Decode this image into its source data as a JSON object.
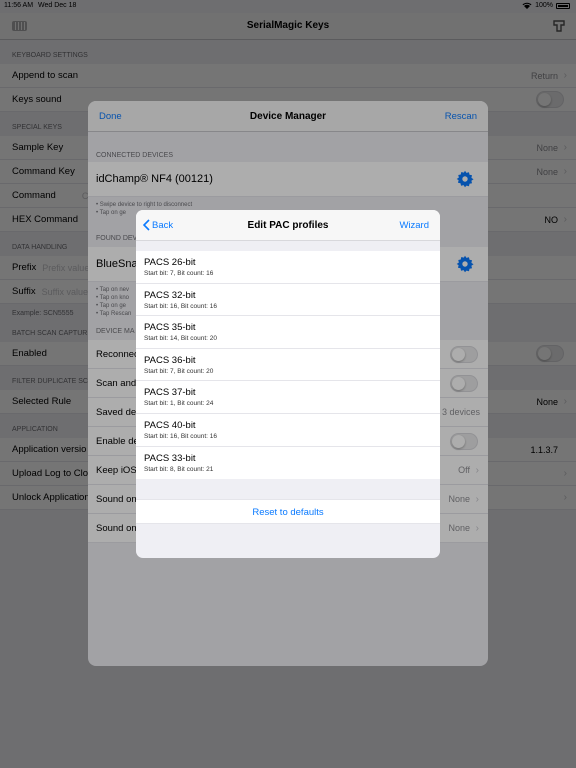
{
  "status_bar": {
    "time": "11:56 AM",
    "date": "Wed Dec 18",
    "battery": "100%"
  },
  "app": {
    "title": "SerialMagic Keys"
  },
  "settings": {
    "keyboard_header": "KEYBOARD SETTINGS",
    "append_label": "Append to scan",
    "append_value": "Return",
    "keys_sound_label": "Keys sound",
    "special_header": "SPECIAL KEYS",
    "sample_key_label": "Sample Key",
    "sample_key_value": "None",
    "command_key_label": "Command Key",
    "command_key_value": "None",
    "command_label": "Command",
    "command_placeholder": "C",
    "hex_label": "HEX Command",
    "hex_value": "NO",
    "data_header": "DATA HANDLING",
    "prefix_label": "Prefix",
    "prefix_placeholder": "Prefix value",
    "suffix_label": "Suffix",
    "suffix_placeholder": "Suffix value",
    "example_text": "Example: SCN5555",
    "batch_header": "BATCH SCAN CAPTUR",
    "enabled_label": "Enabled",
    "filter_header": "FILTER DUPLICATE SC",
    "selected_rule_label": "Selected Rule",
    "selected_rule_value": "None",
    "application_header": "APPLICATION",
    "app_version_label": "Application versio",
    "app_version_value": "1.1.3.7",
    "upload_log_label": "Upload Log to Clo",
    "unlock_label": "Unlock Application"
  },
  "device_manager": {
    "done": "Done",
    "title": "Device Manager",
    "rescan": "Rescan",
    "connected_header": "CONNECTED DEVICES",
    "connected_device": "idChamp® NF4 (00121)",
    "connected_note_1": "• Swipe device to right to disconnect",
    "connected_note_2": "• Tap on ge",
    "found_header": "FOUND DEV",
    "found_device": "BlueSna",
    "found_note_1": "• Tap on nev",
    "found_note_2": "• Tap on kno",
    "found_note_3": "• Tap on ge",
    "found_note_4": "• Tap Rescan",
    "device_mgmt_header": "DEVICE MA",
    "reconnect_label": "Reconnec",
    "scan_and_label": "Scan and",
    "saved_label": "Saved de",
    "saved_value": "3 devices",
    "enable_label": "Enable de",
    "keep_ios_label": "Keep iOS",
    "keep_ios_value": "Off",
    "sound_on_1_label": "Sound on",
    "sound_on_1_value": "None",
    "sound_on_2_label": "Sound on",
    "sound_on_2_value": "None"
  },
  "pac_profiles": {
    "back": "Back",
    "title": "Edit PAC profiles",
    "wizard": "Wizard",
    "items": [
      {
        "name": "PACS 26-bit",
        "detail": "Start bit: 7, Bit count: 16"
      },
      {
        "name": "PACS 32-bit",
        "detail": "Start bit: 16, Bit count: 16"
      },
      {
        "name": "PACS 35-bit",
        "detail": "Start bit: 14, Bit count: 20"
      },
      {
        "name": "PACS 36-bit",
        "detail": "Start bit: 7, Bit count: 20"
      },
      {
        "name": "PACS 37-bit",
        "detail": "Start bit: 1, Bit count: 24"
      },
      {
        "name": "PACS 40-bit",
        "detail": "Start bit: 16, Bit count: 16"
      },
      {
        "name": "PACS 33-bit",
        "detail": "Start bit: 8, Bit count: 21"
      }
    ],
    "reset": "Reset to defaults"
  },
  "colors": {
    "accent": "#0a7aff",
    "background": "#efeff4"
  }
}
